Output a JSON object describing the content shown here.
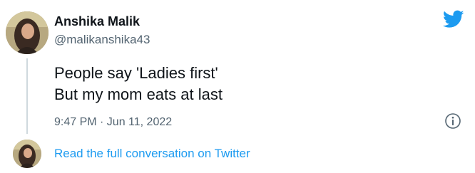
{
  "author": {
    "name": "Anshika Malik",
    "handle": "@malikanshika43"
  },
  "tweet": {
    "lines": [
      "People say 'Ladies first'",
      "But my mom eats at last"
    ],
    "timestamp": "9:47 PM · Jun 11, 2022"
  },
  "footer": {
    "link_text": "Read the full conversation on Twitter"
  },
  "icons": {
    "brand": "twitter-bird-icon",
    "info": "info-icon"
  },
  "colors": {
    "brand_blue": "#1d9bf0",
    "text_primary": "#0f1419",
    "text_secondary": "#536471",
    "thread_line": "#cfd9de"
  }
}
